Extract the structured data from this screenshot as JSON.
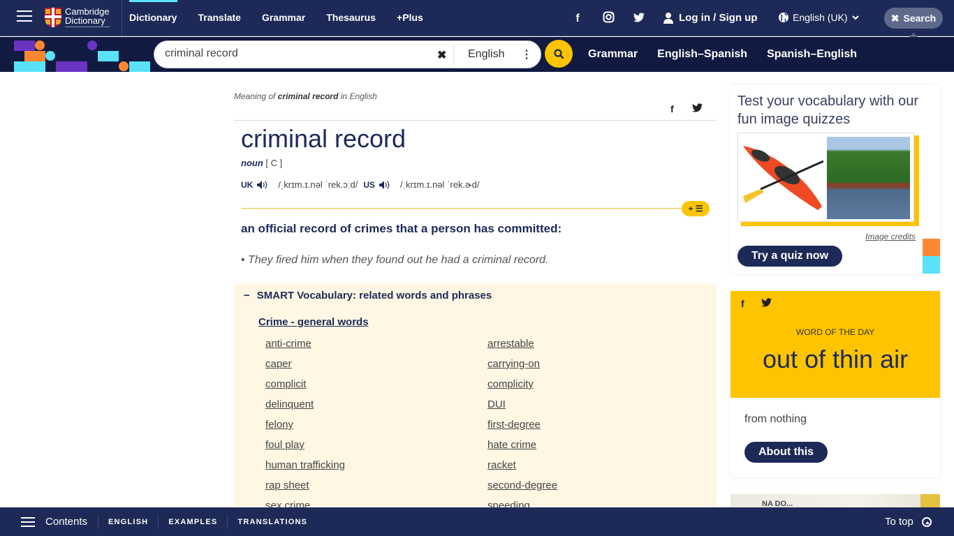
{
  "topbar": {
    "brand_line1": "Cambridge",
    "brand_line2": "Dictionary",
    "nav": [
      "Dictionary",
      "Translate",
      "Grammar",
      "Thesaurus",
      "+Plus"
    ],
    "social": {
      "facebook": "f",
      "instagram": "◎",
      "twitter": "🐦"
    },
    "login_label": "Log in / Sign up",
    "language_label": "English (UK)",
    "search_toggle_label": "Search"
  },
  "searchbar": {
    "query": "criminal record",
    "dictionary_select": "English",
    "subnav": [
      "Grammar",
      "English–Spanish",
      "Spanish–English"
    ]
  },
  "entry": {
    "meaning_prefix": "Meaning of",
    "meaning_word": "criminal record",
    "meaning_suffix": "in English",
    "headword": "criminal record",
    "pos": "noun",
    "grammar": "[ C ]",
    "uk_label": "UK",
    "uk_ipa": "/ˌkrɪm.ɪ.nəl ˈrek.ɔːd/",
    "us_label": "US",
    "us_ipa": "/ˌkrɪm.ɪ.nəl ˈrek.ɚd/",
    "plus_list_label": "+ ☰",
    "definition": "an official record of crimes that a person has committed:",
    "example": "They fired him when they found out he had a criminal record."
  },
  "smart_vocab": {
    "toggle": "−",
    "title": "SMART Vocabulary: related words and phrases",
    "category": "Crime - general words",
    "words": [
      "anti-crime",
      "arrestable",
      "caper",
      "carrying-on",
      "complicit",
      "complicity",
      "delinquent",
      "DUI",
      "felony",
      "first-degree",
      "foul play",
      "hate crime",
      "human trafficking",
      "racket",
      "rap sheet",
      "second-degree",
      "sex crime",
      "speeding"
    ]
  },
  "quiz": {
    "title": "Test your vocabulary with our fun image quizzes",
    "credits": "Image credits",
    "button": "Try a quiz now"
  },
  "wotd": {
    "label": "WORD OF THE DAY",
    "word": "out of thin air",
    "definition": "from nothing",
    "button": "About this"
  },
  "promo": {
    "text": "NA DO..."
  },
  "bottombar": {
    "contents": "Contents",
    "links": [
      "ENGLISH",
      "EXAMPLES",
      "TRANSLATIONS"
    ],
    "to_top": "To top"
  },
  "colors": {
    "navy": "#1d2a57",
    "dark_navy": "#111a40",
    "yellow": "#fec400",
    "cyan": "#5ae3f8",
    "orange": "#fd8731",
    "purple": "#6a33c2",
    "smart_bg": "#fff7e4"
  }
}
